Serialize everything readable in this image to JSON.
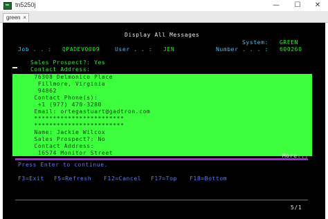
{
  "window": {
    "title": "tn5250j",
    "min_glyph": "—",
    "max_glyph": "☐",
    "close_glyph": "✕"
  },
  "tab": {
    "label": "green",
    "close_glyph": "×"
  },
  "screen": {
    "title": "Display All Messages",
    "system_label": "System:",
    "system_value": "GREEN",
    "job_label": "Job . . :",
    "job_value": "QPADEV0009",
    "user_label": "User . . :",
    "user_value": "JEN",
    "number_label": "Number . . . :",
    "number_value": "600260",
    "line_prospect1": "Sales Prospect?: Yes",
    "line_contact1": "Contact Address:",
    "hl_lines": [
      " 76308 Delmonico Place",
      "  Fillmore, Virginia",
      "  94862",
      " Contact Phone(s):",
      "  +1 (977) 470-3280",
      " Email: ortegastuart@gadtron.com",
      " ************************",
      " ************************",
      " Name: Jackie Wilcox",
      " Sales Prospect?: No",
      " Contact Address:",
      "  16574 Monitor Street"
    ],
    "more": "More...",
    "press_enter": "Press Enter to continue.",
    "fkeys": {
      "f3": "F3=Exit",
      "f5": "F5=Refresh",
      "f12": "F12=Cancel",
      "f17": "F17=Top",
      "f18": "F18=Bottom"
    },
    "page_indicator": "5/1"
  },
  "colors": {
    "terminal_bg": "#000000",
    "field_green": "#32e832",
    "highlight_bg": "#3dff3d",
    "label_blue": "#44c0ff",
    "separator_purple": "#9b30d6"
  }
}
